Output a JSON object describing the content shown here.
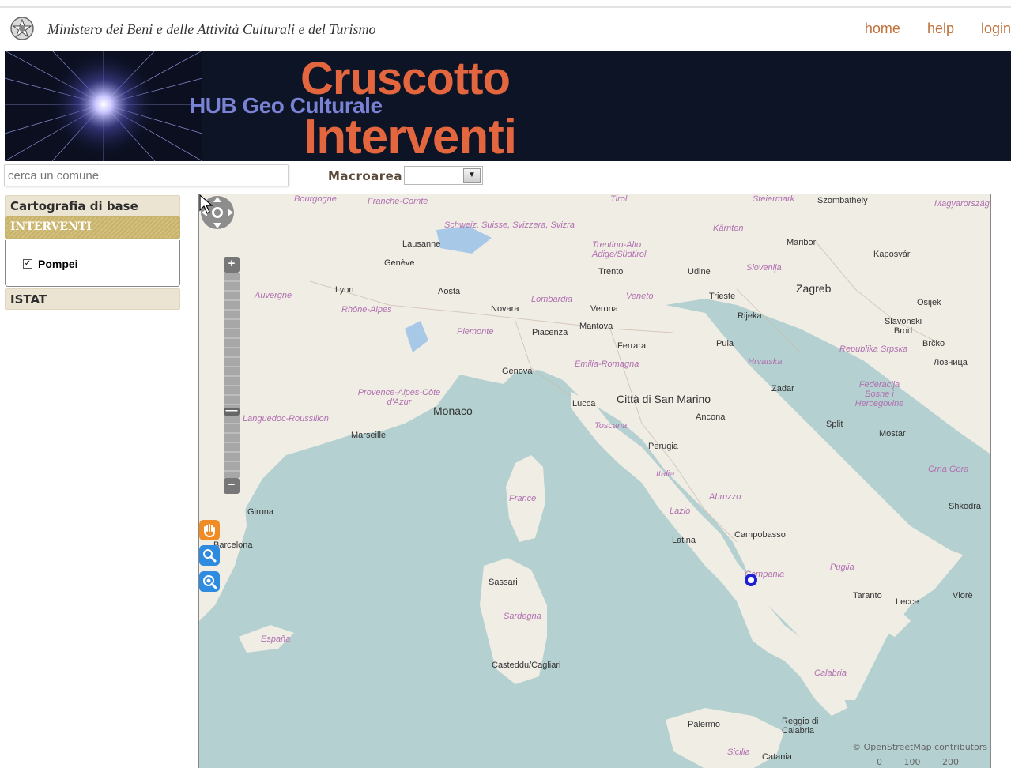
{
  "header": {
    "ministry_title": "Ministero dei Beni e delle Attività Culturali e del Turismo",
    "nav": [
      {
        "label": "home"
      },
      {
        "label": "help"
      },
      {
        "label": "login"
      }
    ]
  },
  "banner": {
    "subtitle": "HUB Geo Culturale",
    "title_line1": "Cruscotto",
    "title_line2": "Interventi"
  },
  "search": {
    "placeholder": "cerca un comune"
  },
  "macroarea": {
    "label": "Macroarea",
    "selected": ""
  },
  "sidebar": {
    "sections": [
      {
        "label": "Cartografia di base"
      },
      {
        "label": "INTERVENTI"
      },
      {
        "label": "ISTAT"
      }
    ],
    "interventi_items": [
      {
        "label": "Pompei",
        "checked": true
      }
    ]
  },
  "map": {
    "attribution": "© OpenStreetMap contributors",
    "scale": [
      "0",
      "100",
      "200"
    ],
    "labels": {
      "zagreb": "Zagreb",
      "szombathely": "Szombathely",
      "magyarorszag": "Magyarország",
      "schweiz": "Schweiz, Suisse, Svizzera, Svizra",
      "lausanne": "Lausanne",
      "geneve": "Genève",
      "lyon": "Lyon",
      "aosta": "Aosta",
      "novara": "Novara",
      "verona": "Verona",
      "trento": "Trento",
      "udine": "Udine",
      "trieste": "Trieste",
      "rijeka": "Rijeka",
      "mantova": "Mantova",
      "piacenza": "Piacenza",
      "ferrara": "Ferrara",
      "genova": "Genova",
      "monaco": "Monaco",
      "marseille": "Marseille",
      "lucca": "Lucca",
      "san_marino": "Città di San Marino",
      "ancona": "Ancona",
      "perugia": "Perugia",
      "france": "France",
      "italia": "Italia",
      "campobasso": "Campobasso",
      "latina": "Latina",
      "sassari": "Sassari",
      "cagliari": "Casteddu/Cagliari",
      "taranto": "Taranto",
      "lecce": "Lecce",
      "palermo": "Palermo",
      "reggio": "Reggio di Calabria",
      "catania": "Catania",
      "girona": "Girona",
      "barcelona": "Barcelona",
      "espana": "España",
      "split": "Split",
      "mostar": "Mostar",
      "zadar": "Zadar",
      "pula": "Pula",
      "hrvatska": "Hrvatska",
      "osijek": "Osijek",
      "maribor": "Maribor",
      "kaposvar": "Kaposvár",
      "slovenija": "Slovenija",
      "crna_gora": "Crna Gora",
      "shkodra": "Shkodra",
      "vlore": "Vlorë",
      "campania": "Campania",
      "puglia": "Puglia",
      "calabria": "Calabria",
      "sardegna": "Sardegna",
      "sicilia": "Sicilia",
      "toscana": "Toscana",
      "lazio": "Lazio",
      "abruzzo": "Abruzzo",
      "emilia": "Emilia-Romagna",
      "lombardia": "Lombardia",
      "veneto": "Veneto",
      "piemonte": "Piemonte",
      "provence": "Provence-Alpes-Côte d'Azur",
      "languedoc": "Languedoc-Roussillon",
      "auvergne": "Auvergne",
      "rhone": "Rhône-Alpes",
      "bourgogne": "Bourgogne",
      "franche": "Franche-Comté",
      "tirol": "Tirol",
      "karnten": "Kärnten",
      "steiermark": "Steiermark",
      "trentino": "Trentino-Alto Adige/Südtirol",
      "brcko": "Brčko",
      "lozica": "Лозница",
      "slavonski": "Slavonski Brod",
      "srpska": "Republika Srpska",
      "federacija": "Federacija Bosne i Hercegovine"
    }
  }
}
